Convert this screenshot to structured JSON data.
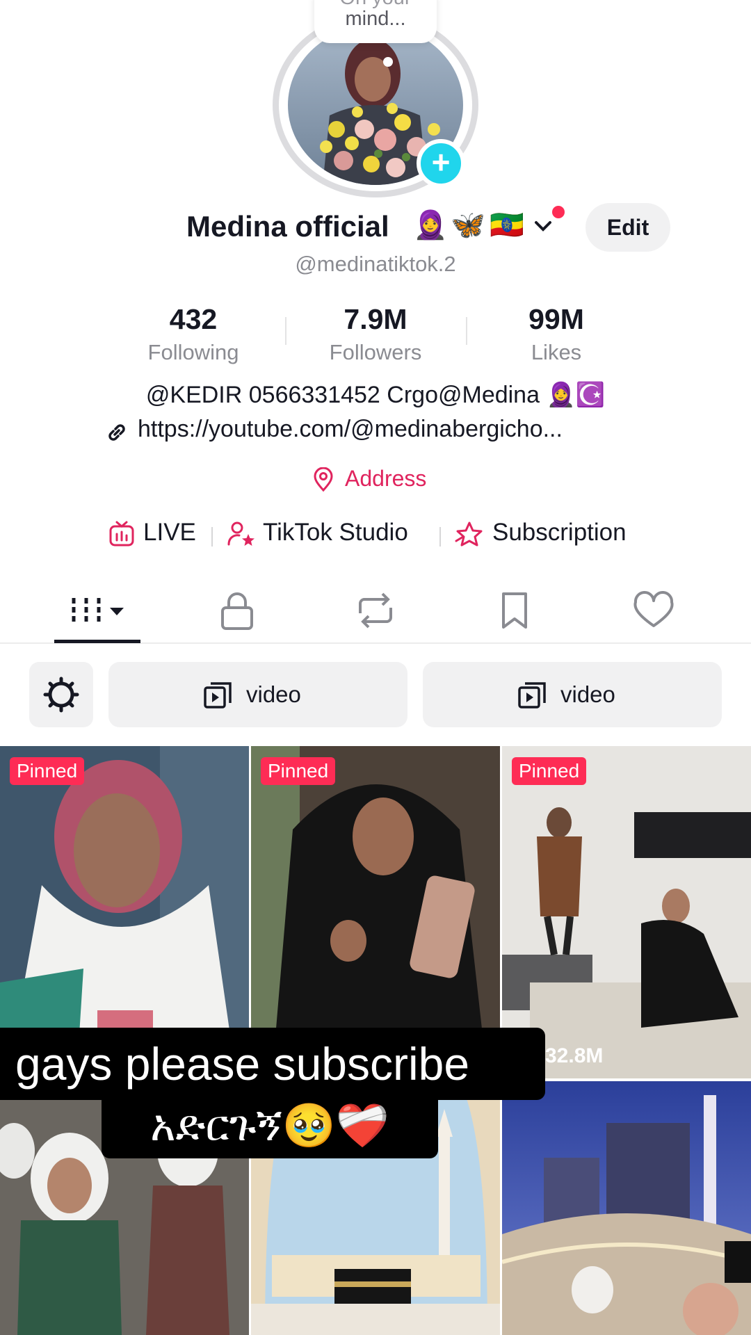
{
  "note": {
    "line1": "On your",
    "line2": "mind..."
  },
  "profile": {
    "display_name": "Medina official",
    "name_emojis": [
      "🧕",
      "🦋",
      "🇪🇹"
    ],
    "handle": "@medinatiktok.2",
    "edit_label": "Edit"
  },
  "stats": [
    {
      "value": "432",
      "label": "Following"
    },
    {
      "value": "7.9M",
      "label": "Followers"
    },
    {
      "value": "99M",
      "label": "Likes"
    }
  ],
  "bio": {
    "line1": "@KEDIR 0566331452 Crgo@Medina 🧕☪️",
    "link": "https://youtube.com/@medinabergicho...",
    "address": "Address"
  },
  "quick_links": [
    {
      "label": "LIVE",
      "icon": "tv-icon"
    },
    {
      "label": "TikTok Studio",
      "icon": "user-star-icon"
    },
    {
      "label": "Subscription",
      "icon": "star-badge-icon"
    }
  ],
  "tabs": [
    {
      "icon": "grid-icon",
      "active": true
    },
    {
      "icon": "lock-icon",
      "active": false
    },
    {
      "icon": "repost-icon",
      "active": false
    },
    {
      "icon": "bookmark-icon",
      "active": false
    },
    {
      "icon": "heart-icon",
      "active": false
    }
  ],
  "filters": {
    "chip1": "video",
    "chip2": "video"
  },
  "videos": {
    "pinned_label": "Pinned",
    "views_3": "32.8M"
  },
  "caption": {
    "line1": "gays please  subscribe",
    "line2": "አድርጉኝ🥹❤️‍🩹"
  },
  "colors": {
    "accent": "#fe2c55",
    "location": "#e0245e",
    "add": "#20d5ec",
    "text": "#161823",
    "muted": "#8a8b91"
  }
}
